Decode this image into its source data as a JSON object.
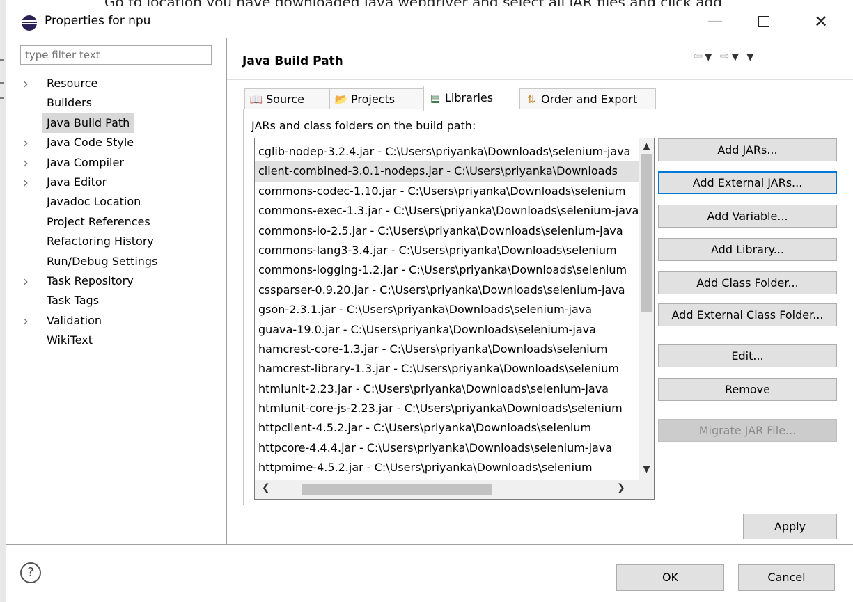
{
  "background": {
    "text": "Go to location you have downloaded Java webdriver and select all JAR files and click add"
  },
  "window": {
    "title": "Properties for npu",
    "minimize_icon": "minimize-icon",
    "maximize_icon": "maximize-icon",
    "close_icon": "close-icon"
  },
  "left_panel": {
    "filter_placeholder": "type filter text",
    "filter_value": "",
    "items": [
      {
        "label": "Resource",
        "expandable": true
      },
      {
        "label": "Builders",
        "expandable": false
      },
      {
        "label": "Java Build Path",
        "expandable": false,
        "selected": true
      },
      {
        "label": "Java Code Style",
        "expandable": true
      },
      {
        "label": "Java Compiler",
        "expandable": true
      },
      {
        "label": "Java Editor",
        "expandable": true
      },
      {
        "label": "Javadoc Location",
        "expandable": false
      },
      {
        "label": "Project References",
        "expandable": false
      },
      {
        "label": "Refactoring History",
        "expandable": false
      },
      {
        "label": "Run/Debug Settings",
        "expandable": false
      },
      {
        "label": "Task Repository",
        "expandable": true
      },
      {
        "label": "Task Tags",
        "expandable": false
      },
      {
        "label": "Validation",
        "expandable": true
      },
      {
        "label": "WikiText",
        "expandable": false
      }
    ]
  },
  "main": {
    "title": "Java Build Path",
    "tabs": [
      {
        "label": "Source",
        "icon": "source-folder-icon"
      },
      {
        "label": "Projects",
        "icon": "projects-folder-icon"
      },
      {
        "label": "Libraries",
        "icon": "libraries-icon",
        "active": true
      },
      {
        "label": "Order and Export",
        "icon": "order-export-icon"
      }
    ],
    "list_caption": "JARs and class folders on the build path:",
    "jars": [
      "cglib-nodep-3.2.4.jar - C:\\Users\\priyanka\\Downloads\\selenium-java",
      "client-combined-3.0.1-nodeps.jar - C:\\Users\\priyanka\\Downloads",
      "commons-codec-1.10.jar - C:\\Users\\priyanka\\Downloads\\selenium",
      "commons-exec-1.3.jar - C:\\Users\\priyanka\\Downloads\\selenium-java",
      "commons-io-2.5.jar - C:\\Users\\priyanka\\Downloads\\selenium-java",
      "commons-lang3-3.4.jar - C:\\Users\\priyanka\\Downloads\\selenium",
      "commons-logging-1.2.jar - C:\\Users\\priyanka\\Downloads\\selenium",
      "cssparser-0.9.20.jar - C:\\Users\\priyanka\\Downloads\\selenium-java",
      "gson-2.3.1.jar - C:\\Users\\priyanka\\Downloads\\selenium-java",
      "guava-19.0.jar - C:\\Users\\priyanka\\Downloads\\selenium-java",
      "hamcrest-core-1.3.jar - C:\\Users\\priyanka\\Downloads\\selenium",
      "hamcrest-library-1.3.jar - C:\\Users\\priyanka\\Downloads\\selenium",
      "htmlunit-2.23.jar - C:\\Users\\priyanka\\Downloads\\selenium-java",
      "htmlunit-core-js-2.23.jar - C:\\Users\\priyanka\\Downloads\\selenium",
      "httpclient-4.5.2.jar - C:\\Users\\priyanka\\Downloads\\selenium",
      "httpcore-4.4.4.jar - C:\\Users\\priyanka\\Downloads\\selenium-java",
      "httpmime-4.5.2.jar - C:\\Users\\priyanka\\Downloads\\selenium"
    ],
    "selected_jar_index": 1,
    "buttons": {
      "add_jars": "Add JARs...",
      "add_external_jars": "Add External JARs...",
      "add_variable": "Add Variable...",
      "add_library": "Add Library...",
      "add_class_folder": "Add Class Folder...",
      "add_external_class_folder": "Add External Class Folder...",
      "edit": "Edit...",
      "remove": "Remove",
      "migrate_jar": "Migrate JAR File..."
    },
    "apply": "Apply"
  },
  "footer": {
    "ok": "OK",
    "cancel": "Cancel",
    "help_icon": "help-icon"
  },
  "colors": {
    "focus_border": "#0078d7",
    "selection": "#d8d8d8"
  }
}
